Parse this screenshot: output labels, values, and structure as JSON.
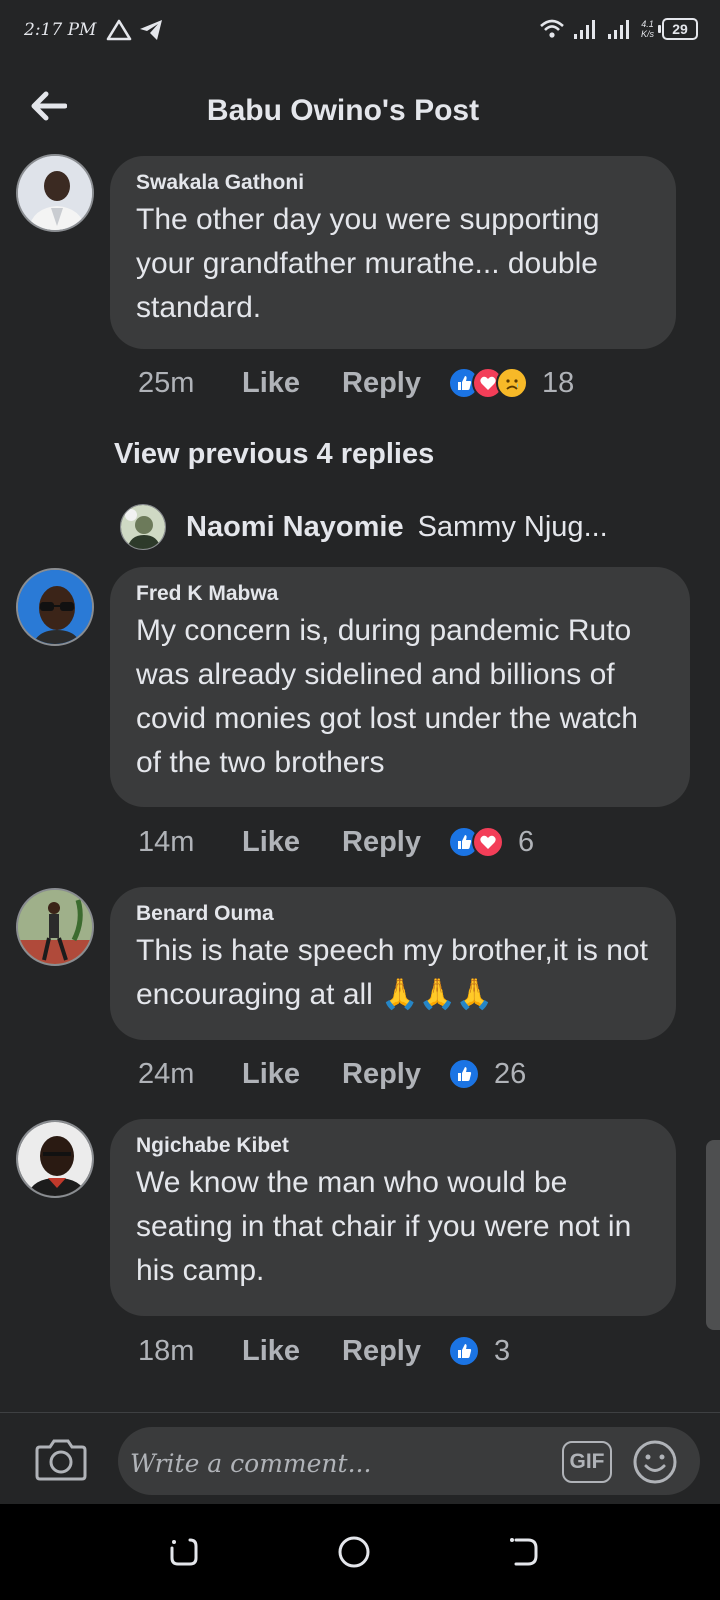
{
  "status_bar": {
    "time": "2:17 PM",
    "network_label_top": "4.1",
    "network_label_bottom": "K/s",
    "battery": "29"
  },
  "header": {
    "title": "Babu Owino's Post",
    "back_icon": "arrow-left-icon"
  },
  "comments": [
    {
      "author": "Swakala Gathoni",
      "text": "The other day you were supporting your grandfather murathe... double standard.",
      "time": "25m",
      "like_label": "Like",
      "reply_label": "Reply",
      "reactions": [
        "like",
        "love",
        "sad"
      ],
      "reaction_count": "18"
    },
    {
      "author": "Fred K Mabwa",
      "text": "My concern is, during pandemic Ruto was already sidelined and billions of covid monies got lost under the watch of the two brothers",
      "time": "14m",
      "like_label": "Like",
      "reply_label": "Reply",
      "reactions": [
        "like",
        "love"
      ],
      "reaction_count": "6"
    },
    {
      "author": "Benard Ouma",
      "text": "This is hate speech my brother,it is not encouraging at all 🙏🙏🙏",
      "time": "24m",
      "like_label": "Like",
      "reply_label": "Reply",
      "reactions": [
        "like"
      ],
      "reaction_count": "26"
    },
    {
      "author": "Ngichabe Kibet",
      "text": "We know the man who would be seating in that chair if you were not in his camp.",
      "time": "18m",
      "like_label": "Like",
      "reply_label": "Reply",
      "reactions": [
        "like"
      ],
      "reaction_count": "3"
    }
  ],
  "view_previous": "View previous 4 replies",
  "reply_preview": {
    "name": "Naomi Nayomie",
    "snippet": "Sammy Njug..."
  },
  "composer": {
    "placeholder": "Write a comment...",
    "gif_label": "GIF"
  },
  "colors": {
    "background": "#242526",
    "bubble": "#3a3b3c",
    "like_blue": "#1b74e4",
    "love_red": "#f33e58",
    "sad_yellow": "#f7b928"
  }
}
